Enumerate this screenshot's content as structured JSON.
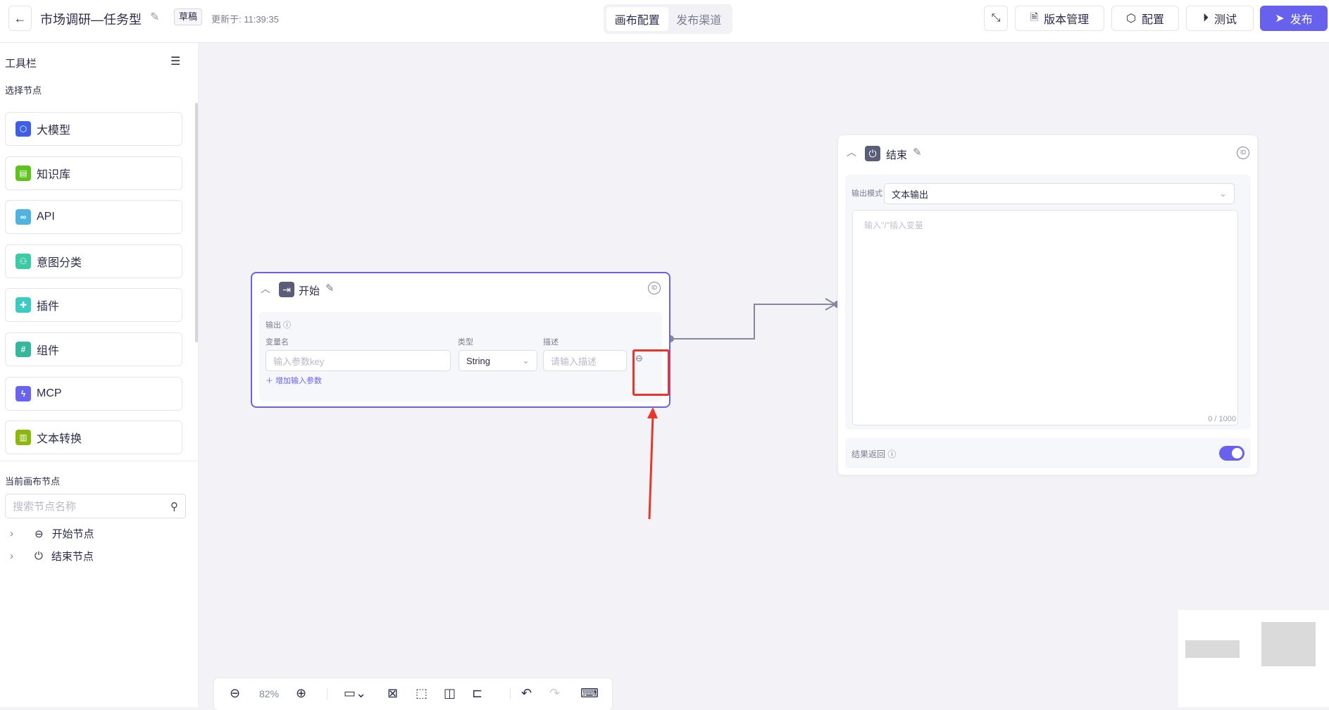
{
  "header": {
    "title": "市场调研—任务型",
    "status_badge": "草稿",
    "updated": "更新于: 11:39:35",
    "tabs": [
      {
        "label": "画布配置",
        "active": true
      },
      {
        "label": "发布渠道",
        "active": false
      }
    ],
    "buttons": {
      "version": "版本管理",
      "config": "配置",
      "test": "测试",
      "publish": "发布"
    }
  },
  "sidebar": {
    "title": "工具栏",
    "select_nodes_label": "选择节点",
    "nodes": [
      {
        "label": "大模型",
        "color": "#3d5ee8",
        "icon": "cube-icon"
      },
      {
        "label": "知识库",
        "color": "#5fc31e",
        "icon": "inbox-icon"
      },
      {
        "label": "API",
        "color": "#4fb3e2",
        "icon": "link-icon"
      },
      {
        "label": "意图分类",
        "color": "#3fcaa6",
        "icon": "hierarchy-icon"
      },
      {
        "label": "插件",
        "color": "#3ccbc3",
        "icon": "puzzle-icon"
      },
      {
        "label": "组件",
        "color": "#34b79a",
        "icon": "hash-icon"
      },
      {
        "label": "MCP",
        "color": "#6a63f0",
        "icon": "bolt-icon"
      },
      {
        "label": "文本转换",
        "color": "#8cb80e",
        "icon": "layout-icon"
      }
    ],
    "canvas_nodes_label": "当前画布节点",
    "search_placeholder": "搜索节点名称",
    "tree": [
      {
        "label": "开始节点"
      },
      {
        "label": "结束节点"
      }
    ]
  },
  "start_node": {
    "title": "开始",
    "output_label": "输出",
    "col_name": "变量名",
    "col_type": "类型",
    "col_desc": "描述",
    "name_placeholder": "输入参数key",
    "type_value": "String",
    "desc_placeholder": "请输入描述",
    "add_param": "增加输入参数"
  },
  "end_node": {
    "title": "结束",
    "mode_label": "输出模式",
    "mode_value": "文本输出",
    "text_placeholder": "输入\"/\"插入变量",
    "counter": "0 / 1000",
    "return_label": "结果返回",
    "return_enabled": true
  },
  "toolbar": {
    "zoom": "82%"
  },
  "colors": {
    "accent": "#6761ee",
    "highlight": "#e8372a"
  }
}
